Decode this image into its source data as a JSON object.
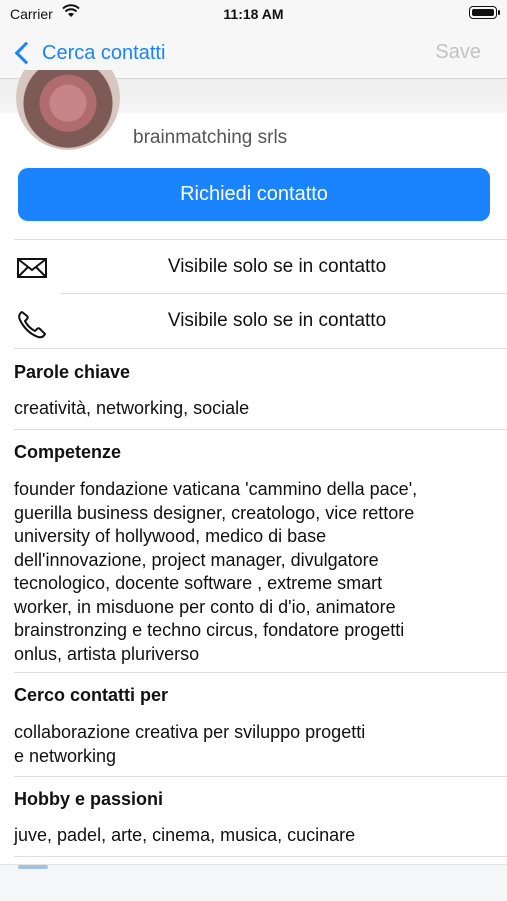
{
  "status_bar": {
    "carrier": "Carrier",
    "time": "11:18 AM"
  },
  "nav": {
    "back_label": "Cerca contatti",
    "save_label": "Save"
  },
  "profile": {
    "company": "brainmatching srls"
  },
  "cta": {
    "label": "Richiedi contatto"
  },
  "contact_rows": [
    {
      "icon": "mail-icon",
      "text": "Visibile solo se in contatto"
    },
    {
      "icon": "phone-icon",
      "text": "Visibile solo se in contatto"
    }
  ],
  "sections": [
    {
      "title": "Parole chiave",
      "body": "creatività, networking, sociale"
    },
    {
      "title": "Competenze",
      "body": [
        "founder fondazione vaticana 'cammino della pace',",
        "guerilla business designer, creatologo, vice rettore",
        "university of hollywood, medico di base",
        "dell'innovazione, project manager, divulgatore",
        "tecnologico, docente software , extreme smart",
        "worker, in misduone per conto di d'io, animatore",
        "brainstronzing e techno circus, fondatore progetti",
        "onlus, artista pluriverso"
      ]
    },
    {
      "title": "Cerco contatti per",
      "body": [
        "collaborazione creativa per sviluppo progetti",
        "e networking"
      ]
    },
    {
      "title": "Hobby e passioni",
      "body": "juve, padel, arte, cinema, musica, cucinare"
    }
  ],
  "colors": {
    "accent": "#1a84ff",
    "disabled": "#c2c2c2",
    "separator": "#dedede"
  }
}
